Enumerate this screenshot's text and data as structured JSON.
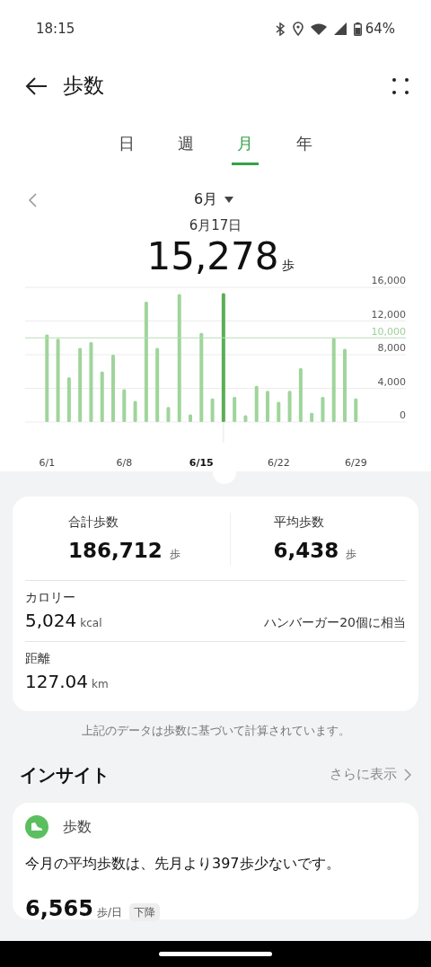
{
  "status_bar": {
    "time": "18:15",
    "battery": "64%"
  },
  "header": {
    "title": "歩数"
  },
  "tabs": [
    {
      "label": "日",
      "selected": false
    },
    {
      "label": "週",
      "selected": false
    },
    {
      "label": "月",
      "selected": true
    },
    {
      "label": "年",
      "selected": false
    }
  ],
  "period": {
    "label": "6月"
  },
  "selected_day": {
    "date": "6月17日",
    "value": "15,278",
    "unit": "歩"
  },
  "chart_data": {
    "type": "bar",
    "grid": true,
    "categories": [
      "6/1",
      null,
      null,
      null,
      null,
      null,
      null,
      "6/8",
      null,
      null,
      null,
      null,
      null,
      null,
      "6/15",
      null,
      null,
      null,
      null,
      null,
      null,
      "6/22",
      null,
      null,
      null,
      null,
      null,
      null,
      "6/29"
    ],
    "series": [
      {
        "color": "#9fd59b",
        "values": [
          10400,
          9900,
          5300,
          8800,
          9500,
          6000,
          8000,
          3900,
          2500,
          14300,
          8800,
          1800,
          15200,
          900,
          10600,
          2800,
          null,
          3000,
          800,
          4300,
          3700,
          2400,
          3700,
          6400,
          1100,
          3000,
          10000,
          8700,
          2800
        ]
      },
      {
        "color": "#5aaf55",
        "values": [
          null,
          null,
          null,
          null,
          null,
          null,
          null,
          null,
          null,
          null,
          null,
          null,
          null,
          null,
          null,
          null,
          15300,
          null,
          null,
          null,
          null,
          null,
          null,
          null,
          null,
          null,
          null,
          null,
          null
        ]
      }
    ],
    "ylim": [
      0,
      16000
    ],
    "yticks": [
      {
        "value": 0,
        "label": "0"
      },
      {
        "value": 4000,
        "label": "4,000"
      },
      {
        "value": 8000,
        "label": "8,000"
      },
      {
        "value": 12000,
        "label": "12,000"
      },
      {
        "value": 16000,
        "label": "16,000"
      }
    ],
    "ref_lines": [
      {
        "axis": "y",
        "value": 10000,
        "label": "10,000"
      }
    ]
  },
  "summary": [
    {
      "label": "合計歩数",
      "value": "186,712",
      "unit": "歩"
    },
    {
      "label": "平均歩数",
      "value": "6,438",
      "unit": "歩"
    }
  ],
  "details": [
    {
      "label": "カロリー",
      "value": "5,024",
      "unit": "kcal",
      "note": "ハンバーガー20個に相当"
    },
    {
      "label": "距離",
      "value": "127.04",
      "unit": "km"
    }
  ],
  "footnote": "上記のデータは歩数に基づいて計算されています。",
  "insights": {
    "title": "インサイト",
    "more": "さらに表示",
    "card": {
      "title": "歩数",
      "text": "今月の平均歩数は、先月より397歩少ないです。",
      "value": "6,565",
      "unit": "歩/日",
      "badge": "下降"
    }
  }
}
